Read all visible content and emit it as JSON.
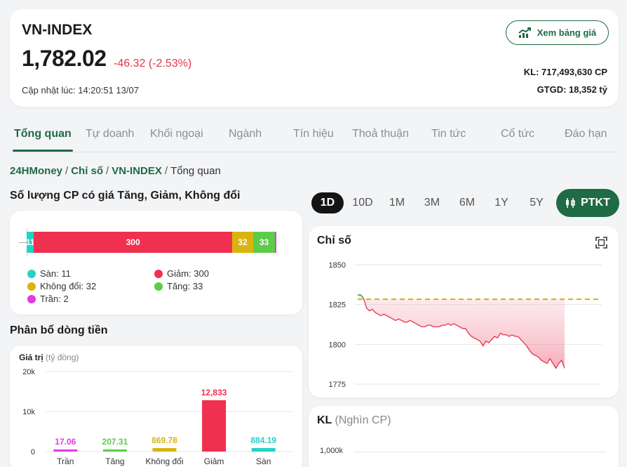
{
  "header": {
    "index_name": "VN-INDEX",
    "price": "1,782.02",
    "change": "-46.32 (-2.53%)",
    "updated": "Cập nhật lúc: 14:20:51 13/07",
    "board_button": "Xem bảng giá",
    "volume": "KL: 717,493,630 CP",
    "value": "GTGD: 18,352 tỷ"
  },
  "tabs": [
    "Tổng quan",
    "Tự doanh",
    "Khối ngoại",
    "Ngành",
    "Tín hiệu",
    "Thoả thuận",
    "Tin tức",
    "Cổ tức",
    "Đáo hạn"
  ],
  "breadcrumb": {
    "home": "24HMoney",
    "cat": "Chỉ số",
    "index": "VN-INDEX",
    "current": "Tổng quan",
    "sep": "/"
  },
  "count_section": {
    "title": "Số lượng CP có giá Tăng, Giảm, Không đổi",
    "legend": [
      {
        "label": "Sàn: 11",
        "color": "#22d3c5"
      },
      {
        "label": "Giảm: 300",
        "color": "#f0304f"
      },
      {
        "label": "Không đổi: 32",
        "color": "#d9b410"
      },
      {
        "label": "Tăng: 33",
        "color": "#5ccc4a"
      },
      {
        "label": "Trần: 2",
        "color": "#e43be0"
      }
    ]
  },
  "flow_section": {
    "title": "Phân bổ dòng tiền",
    "axis_title": "Giá trị",
    "axis_unit": "(tỷ đồng)"
  },
  "periods": [
    "1D",
    "10D",
    "1M",
    "3M",
    "6M",
    "1Y",
    "5Y"
  ],
  "ptkt_button": "PTKT",
  "index_card": {
    "title": "Chỉ số"
  },
  "kl_card": {
    "title": "KL",
    "unit": "(Nghìn CP)",
    "tick": "1,000k"
  },
  "colors": {
    "brand": "#1e6b45",
    "down": "#e5334b",
    "reference": "#e0a90c"
  },
  "chart_data": [
    {
      "type": "bar",
      "orientation": "horizontal-stacked",
      "categories": [
        "Sàn",
        "Giảm",
        "Không đổi",
        "Tăng",
        "Trần"
      ],
      "values": [
        11,
        300,
        32,
        33,
        2
      ],
      "colors": [
        "#22d3c5",
        "#f0304f",
        "#d9b410",
        "#5ccc4a",
        "#e43be0"
      ],
      "legend": "bottom"
    },
    {
      "type": "bar",
      "categories": [
        "Trần",
        "Tăng",
        "Không đổi",
        "Giảm",
        "Sàn"
      ],
      "values": [
        17.06,
        207.31,
        869.78,
        12833,
        884.19
      ],
      "labels": [
        "17.06",
        "207.31",
        "869.78",
        "12,833",
        "884.19"
      ],
      "colors": [
        "#e43be0",
        "#5ccc4a",
        "#d9b410",
        "#f0304f",
        "#22d3c5"
      ],
      "yticks": [
        "0",
        "10k",
        "20k"
      ],
      "ylim": [
        0,
        20000
      ],
      "grid": true
    },
    {
      "type": "area",
      "title": "Chỉ số",
      "yticks": [
        "1850",
        "1825",
        "1800",
        "1775"
      ],
      "ylim": [
        1770,
        1855
      ],
      "reference": 1828.34,
      "y": [
        1831,
        1831,
        1829,
        1823,
        1821,
        1822,
        1820,
        1819,
        1818,
        1819,
        1818,
        1817,
        1816,
        1815,
        1816,
        1815,
        1814,
        1814,
        1815,
        1814,
        1813,
        1812,
        1811,
        1811,
        1812,
        1812,
        1811,
        1811,
        1811,
        1812,
        1812,
        1813,
        1812,
        1813,
        1812,
        1811,
        1810,
        1810,
        1807,
        1805,
        1804,
        1803,
        1802,
        1799,
        1802,
        1801,
        1803,
        1805,
        1804,
        1807,
        1806,
        1806,
        1805,
        1806,
        1805,
        1805,
        1803,
        1801,
        1799,
        1796,
        1794,
        1793,
        1792,
        1790,
        1789,
        1788,
        1791,
        1788,
        1785,
        1788,
        1790,
        1785
      ]
    }
  ]
}
